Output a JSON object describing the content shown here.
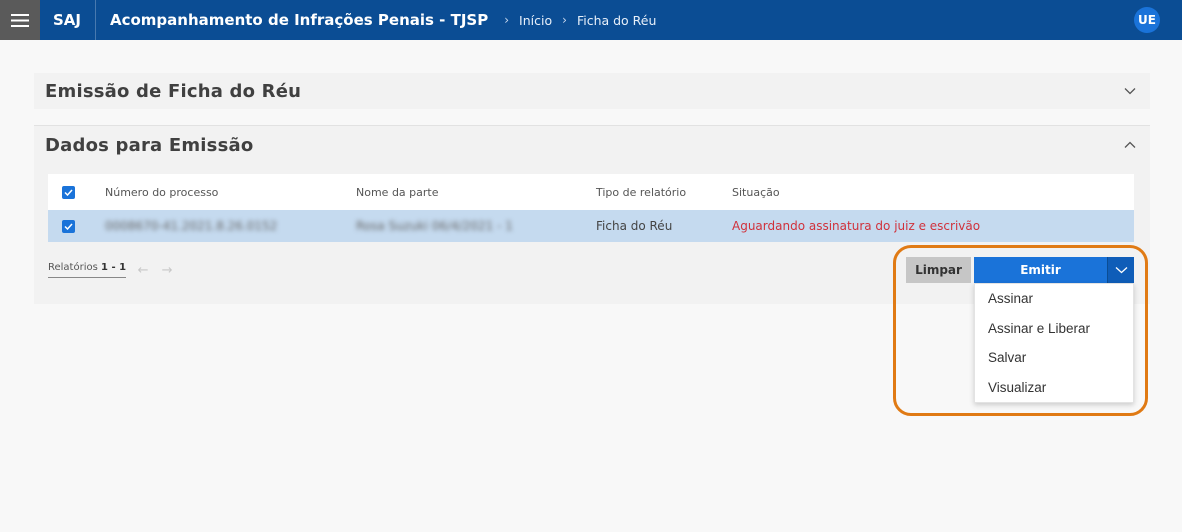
{
  "header": {
    "brand": "SAJ",
    "title": "Acompanhamento de Infrações Penais - TJSP",
    "breadcrumb": [
      "Início",
      "Ficha do Réu"
    ],
    "avatar_initials": "UE"
  },
  "panels": {
    "emissao_title": "Emissão de Ficha do Réu",
    "dados_title": "Dados para Emissão"
  },
  "table": {
    "columns": [
      "Número do processo",
      "Nome da parte",
      "Tipo de relatório",
      "Situação"
    ],
    "rows": [
      {
        "numero_processo": "0008670-41.2021.8.26.0152",
        "nome_parte": "Rosa Suzuki 06/4/2021 - 1",
        "tipo_relatorio": "Ficha do Réu",
        "situacao": "Aguardando assinatura do juiz e escrivão",
        "checked": true
      }
    ]
  },
  "pager": {
    "label": "Relatórios",
    "range": "1 - 1"
  },
  "actions": {
    "limpar_label": "Limpar",
    "emitir_label": "Emitir",
    "dropdown_items": [
      "Assinar",
      "Assinar e Liberar",
      "Salvar",
      "Visualizar"
    ]
  },
  "colors": {
    "topbar": "#0b4d94",
    "accent": "#1a73d9",
    "selected_row": "#c5daef",
    "status_text": "#d0313b",
    "highlight": "#e07a14"
  },
  "icons": [
    "menu-icon",
    "chevron-right-icon",
    "chevron-down-icon",
    "chevron-up-icon",
    "check-icon",
    "arrow-left-icon",
    "arrow-right-icon"
  ]
}
